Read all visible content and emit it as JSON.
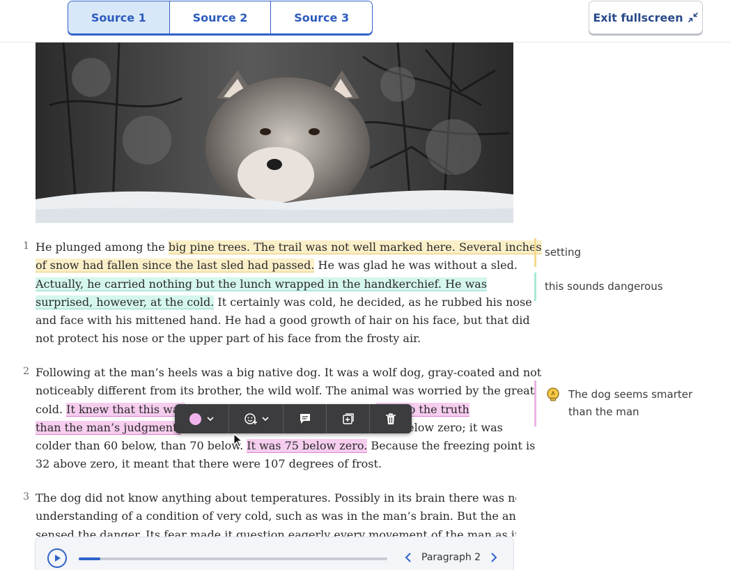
{
  "tabs": [
    {
      "label": "Source 1",
      "active": true
    },
    {
      "label": "Source 2",
      "active": false
    },
    {
      "label": "Source 3",
      "active": false
    }
  ],
  "exit_button": {
    "label": "Exit fullscreen",
    "icon": "collapse-arrows-icon"
  },
  "hero_image": {
    "subject": "wolf-in-snow"
  },
  "paragraphs": [
    {
      "number": "1",
      "lines": [
        [
          {
            "t": "He plunged among the "
          },
          {
            "t": "big pine trees. The trail was not well marked here. Several inches",
            "hl": "y"
          }
        ],
        [
          {
            "t": "of snow had fallen since the last sled had passed.",
            "hl": "y"
          },
          {
            "t": " He was glad he was without a sled."
          }
        ],
        [
          {
            "t": "Actually, he carried nothing but the lunch wrapped in the handkerchief. He was",
            "hl": "g"
          }
        ],
        [
          {
            "t": "surprised, however, at the cold.",
            "hl": "g"
          },
          {
            "t": " It certainly was cold, he decided, as he rubbed his nose"
          }
        ],
        [
          {
            "t": "and face with his mittened hand. He had a good growth of hair on his face, but that did"
          }
        ],
        [
          {
            "t": "not protect his nose or the upper part of his face from the frosty air."
          }
        ]
      ]
    },
    {
      "number": "2",
      "lines": [
        [
          {
            "t": "Following at the man’s heels was a big native dog. It was a wolf dog, gray-coated and not"
          }
        ],
        [
          {
            "t": "noticeably different from its brother, the wild wolf. The animal was worried by the great"
          }
        ],
        [
          {
            "t": "cold. "
          },
          {
            "t": "It knew that this was",
            "hl": "p"
          },
          {
            "t": "                                                      "
          },
          {
            "t": "oser to the truth",
            "hl": "p"
          }
        ],
        [
          {
            "t": "than the man’s judgment.",
            "hl": "p"
          },
          {
            "t": "                                                              below zero; it was"
          }
        ],
        [
          {
            "t": "colder than 60 below, than 70 below. "
          },
          {
            "t": "It was 75 below zero.",
            "hl": "p"
          },
          {
            "t": " Because the freezing point is"
          }
        ],
        [
          {
            "t": "32 above zero, it meant that there were 107 degrees of frost."
          }
        ]
      ]
    },
    {
      "number": "3",
      "lines": [
        [
          {
            "t": "The dog did not know anything about temperatures. Possibly in its brain there was no"
          }
        ],
        [
          {
            "t": "understanding of a condition of very cold, such as was in the man’s brain. But the animal"
          }
        ],
        [
          {
            "t": "sensed the danger. Its fear made it question eagerly every movement of the man as if"
          }
        ]
      ]
    }
  ],
  "notes": [
    {
      "text": "setting",
      "color": "#f4d98c"
    },
    {
      "text": "this sounds dangerous",
      "color": "#a8ead8"
    },
    {
      "text": "The dog seems smarter than the man",
      "line1": "The dog seems smarter",
      "line2": "than the man",
      "color": "#eab4e3",
      "icon": "lightbulb-icon"
    }
  ],
  "toolbar": {
    "items": [
      "color-picker",
      "emoji-picker",
      "comment",
      "add-note",
      "delete"
    ],
    "highlight_color": "#f2b3ec"
  },
  "player": {
    "progress": 0.07,
    "paragraph_label": "Paragraph 2"
  },
  "colors": {
    "accent": "#2f62c8",
    "yellow": "#fbefc8",
    "green": "#d4f6ee",
    "pink": "#f6cdef"
  }
}
